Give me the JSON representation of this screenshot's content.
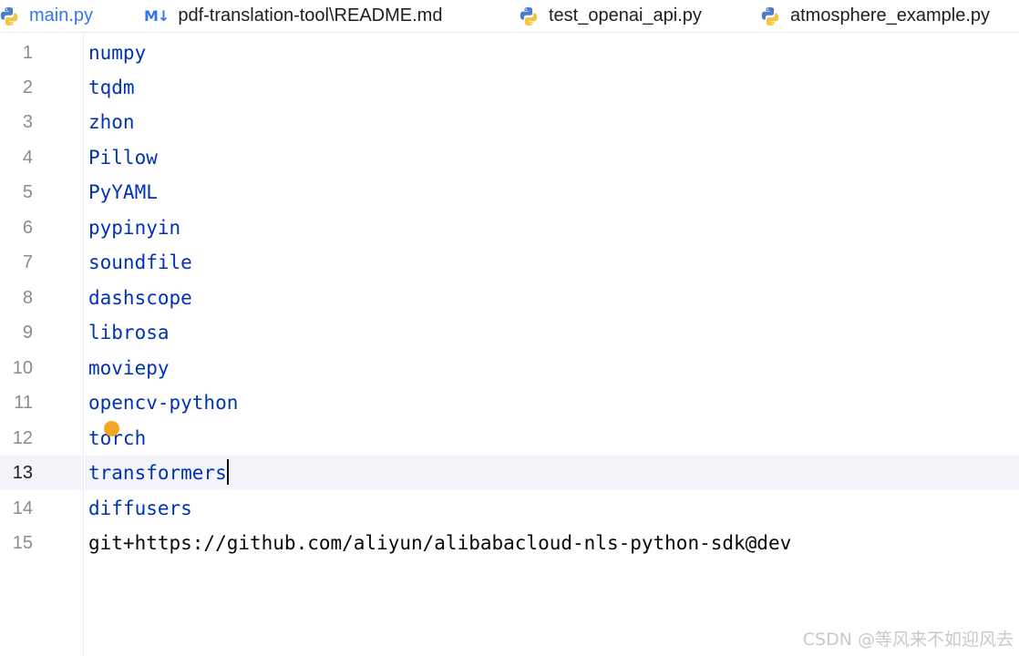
{
  "tabs": [
    {
      "label": "main.py",
      "icon": "python-icon",
      "active": true
    },
    {
      "label": "pdf-translation-tool\\README.md",
      "icon": "markdown-icon",
      "icon_text": "M↓",
      "active": false
    },
    {
      "label": "test_openai_api.py",
      "icon": "python-icon",
      "active": false
    },
    {
      "label": "atmosphere_example.py",
      "icon": "python-icon",
      "active": false
    }
  ],
  "editor": {
    "current_line": 13,
    "lines": [
      {
        "num": "1",
        "text": "numpy"
      },
      {
        "num": "2",
        "text": "tqdm"
      },
      {
        "num": "3",
        "text": "zhon"
      },
      {
        "num": "4",
        "text": "Pillow"
      },
      {
        "num": "5",
        "text": "PyYAML"
      },
      {
        "num": "6",
        "text": "pypinyin"
      },
      {
        "num": "7",
        "text": "soundfile"
      },
      {
        "num": "8",
        "text": "dashscope"
      },
      {
        "num": "9",
        "text": "librosa"
      },
      {
        "num": "10",
        "text": "moviepy"
      },
      {
        "num": "11",
        "text": "opencv-python"
      },
      {
        "num": "12",
        "text": "torch"
      },
      {
        "num": "13",
        "text": "transformers"
      },
      {
        "num": "14",
        "text": "diffusers"
      },
      {
        "num": "15",
        "text": "git+https://github.com/aliyun/alibabacloud-nls-python-sdk@dev"
      }
    ]
  },
  "colors": {
    "package_name": "#0033b3",
    "url_text": "#080808",
    "line_number": "#8c8c8c",
    "current_line_bg": "#f4f5fb",
    "active_tab": "#3574f0",
    "bulb": "#f5a623"
  },
  "watermark": "CSDN @等风来不如迎风去"
}
